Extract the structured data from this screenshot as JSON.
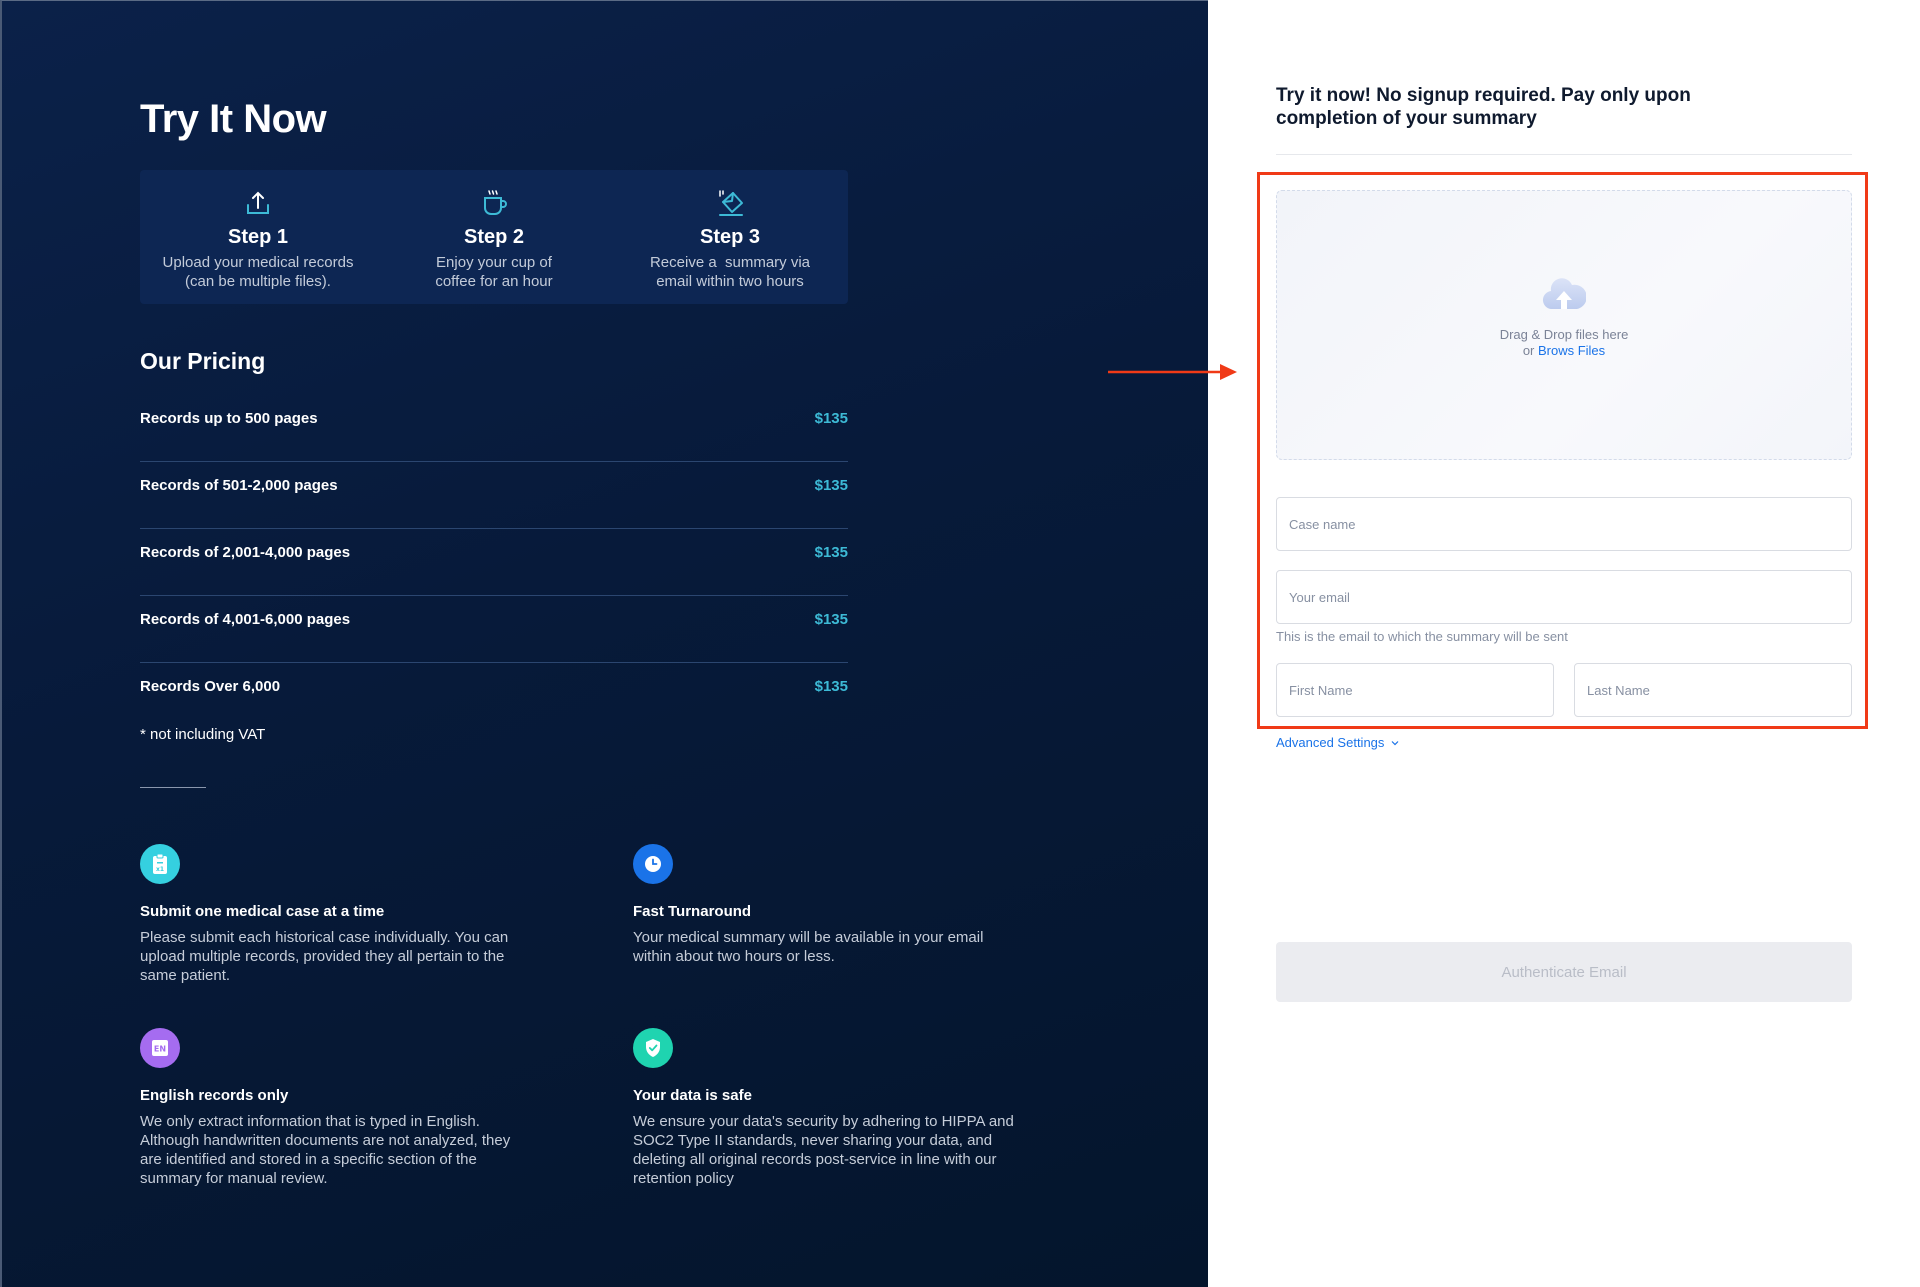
{
  "left": {
    "title": "Try It Now",
    "steps": [
      {
        "icon": "upload-icon",
        "title": "Step 1",
        "desc_line1": "Upload your medical records",
        "desc_line2": "(can be multiple files)."
      },
      {
        "icon": "coffee-cup-icon",
        "title": "Step 2",
        "desc_line1": "Enjoy your cup of",
        "desc_line2": "coffee for an hour"
      },
      {
        "icon": "email-receive-icon",
        "title": "Step 3",
        "desc_line1": "Receive a  summary via",
        "desc_line2": "email within two hours"
      }
    ],
    "pricing": {
      "title": "Our Pricing",
      "rows": [
        {
          "label": "Records up to 500 pages",
          "price": "$135"
        },
        {
          "label": "Records of 501-2,000 pages",
          "price": "$135"
        },
        {
          "label": "Records of 2,001-4,000 pages",
          "price": "$135"
        },
        {
          "label": "Records of 4,001-6,000 pages",
          "price": "$135"
        },
        {
          "label": "Records Over 6,000",
          "price": "$135"
        }
      ],
      "note": "* not including VAT"
    },
    "features": [
      {
        "icon": "clipboard-x1-icon",
        "color": "#35d0e0",
        "title": "Submit one medical case at a time",
        "body": [
          "Please submit each historical case individually. You can",
          "upload multiple records, provided they all pertain to the",
          "same patient."
        ]
      },
      {
        "icon": "clock-icon",
        "color": "#1a73e8",
        "title": "Fast Turnaround",
        "body": [
          "Your medical summary will be available in your email",
          "within about two hours or less."
        ]
      },
      {
        "icon": "language-en-icon",
        "color": "#a56cf0",
        "badge": "EN",
        "title": "English records only",
        "body": [
          "We only extract information that is typed in English.",
          "Although handwritten documents are not analyzed, they",
          "are identified and stored in a specific section of the",
          "summary for manual review."
        ]
      },
      {
        "icon": "shield-check-icon",
        "color": "#1fd4b0",
        "title": "Your data is safe",
        "body": [
          "We ensure your data's security by adhering to HIPPA and",
          "SOC2 Type II standards, never sharing your data, and",
          "deleting all original records post-service in line with our",
          "retention policy"
        ]
      }
    ]
  },
  "form": {
    "title": "Try it now! No signup required. Pay only upon completion of your summary",
    "dropzone": {
      "text": "Drag & Drop files here",
      "or": "or ",
      "browse_link": "Brows Files"
    },
    "case_name": {
      "placeholder": "Case name",
      "value": ""
    },
    "email": {
      "placeholder": "Your email",
      "value": "",
      "hint": "This is the email to which the summary will be sent"
    },
    "first_name": {
      "placeholder": "First Name",
      "value": ""
    },
    "last_name": {
      "placeholder": "Last Name",
      "value": ""
    },
    "advanced_settings": "Advanced Settings",
    "submit": "Authenticate Email"
  },
  "colors": {
    "accent": "#3dbad6",
    "link": "#1a73e8",
    "highlight": "#f03a17",
    "panel_dark": "#071a3a"
  }
}
